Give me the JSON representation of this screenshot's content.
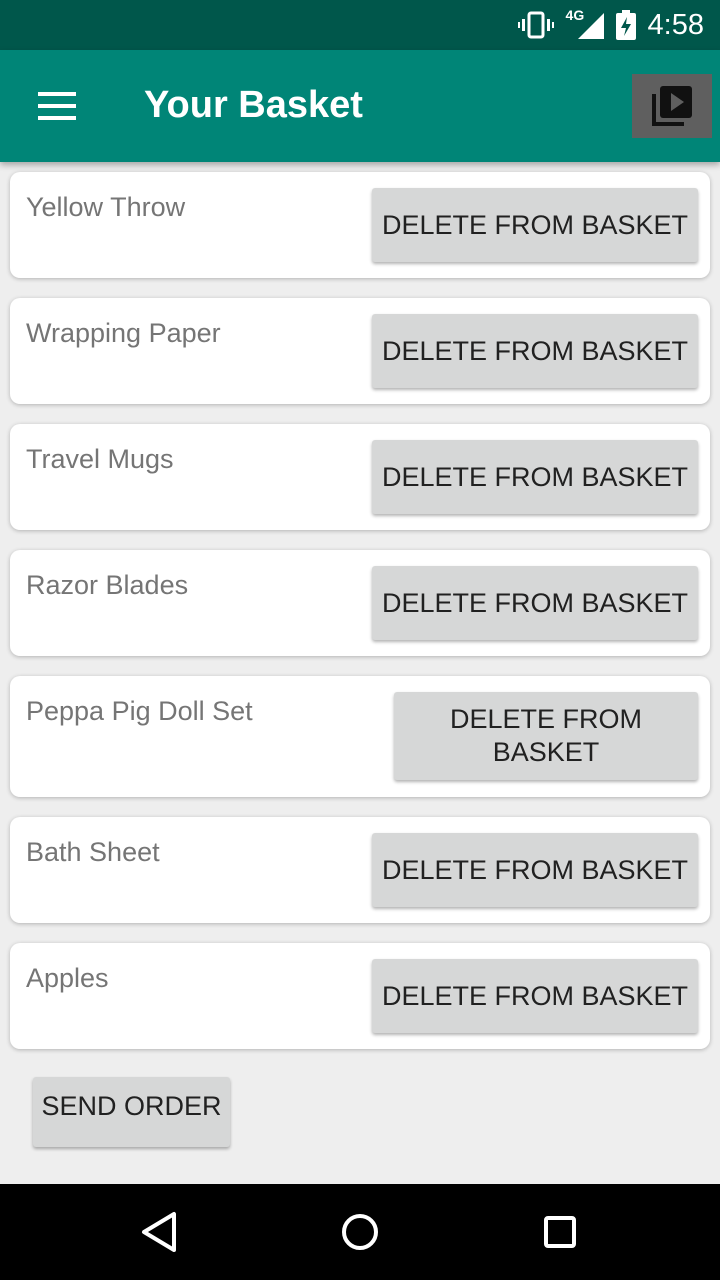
{
  "status_bar": {
    "network": "4G",
    "time": "4:58",
    "icons": [
      "vibrate-icon",
      "signal-icon",
      "battery-charging-icon"
    ]
  },
  "toolbar": {
    "title": "Your Basket",
    "menu_icon": "hamburger-menu-icon",
    "action_icon": "video-library-icon"
  },
  "basket": {
    "items": [
      {
        "name": "Yellow Throw",
        "button_label": "DELETE FROM BASKET"
      },
      {
        "name": "Wrapping Paper",
        "button_label": "DELETE FROM BASKET"
      },
      {
        "name": "Travel Mugs",
        "button_label": "DELETE FROM BASKET"
      },
      {
        "name": "Razor Blades",
        "button_label": "DELETE FROM BASKET"
      },
      {
        "name": "Peppa Pig Doll Set",
        "button_label": "DELETE FROM BASKET"
      },
      {
        "name": "Bath Sheet",
        "button_label": "DELETE FROM BASKET"
      },
      {
        "name": "Apples",
        "button_label": "DELETE FROM BASKET"
      }
    ],
    "send_label": "SEND ORDER"
  },
  "nav_bar": {
    "icons": [
      "back-icon",
      "home-icon",
      "recents-icon"
    ]
  },
  "colors": {
    "primary": "#008577",
    "primary_dark": "#00574b",
    "button_bg": "#d6d7d7"
  }
}
